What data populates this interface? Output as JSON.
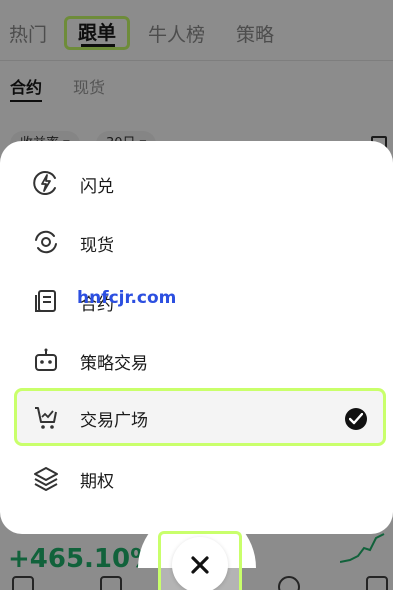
{
  "top_tabs": [
    "热门",
    "跟单",
    "牛人榜",
    "策略"
  ],
  "sub_tabs": [
    "合约",
    "现货"
  ],
  "filters": [
    "收益率 ▾",
    "30日 ▾"
  ],
  "profit_text": "+465.10%",
  "menu": {
    "items": [
      {
        "label": "闪兑",
        "icon": "lightning-circle-icon"
      },
      {
        "label": "现货",
        "icon": "currency-circle-icon"
      },
      {
        "label": "合约",
        "icon": "contract-book-icon"
      },
      {
        "label": "策略交易",
        "icon": "robot-icon"
      },
      {
        "label": "交易广场",
        "icon": "cart-chart-icon",
        "selected": true
      },
      {
        "label": "期权",
        "icon": "layers-icon"
      }
    ]
  },
  "watermark": "hnfcjr.com",
  "colors": {
    "highlight": "#c9ff6b",
    "profit": "#20b26c"
  }
}
